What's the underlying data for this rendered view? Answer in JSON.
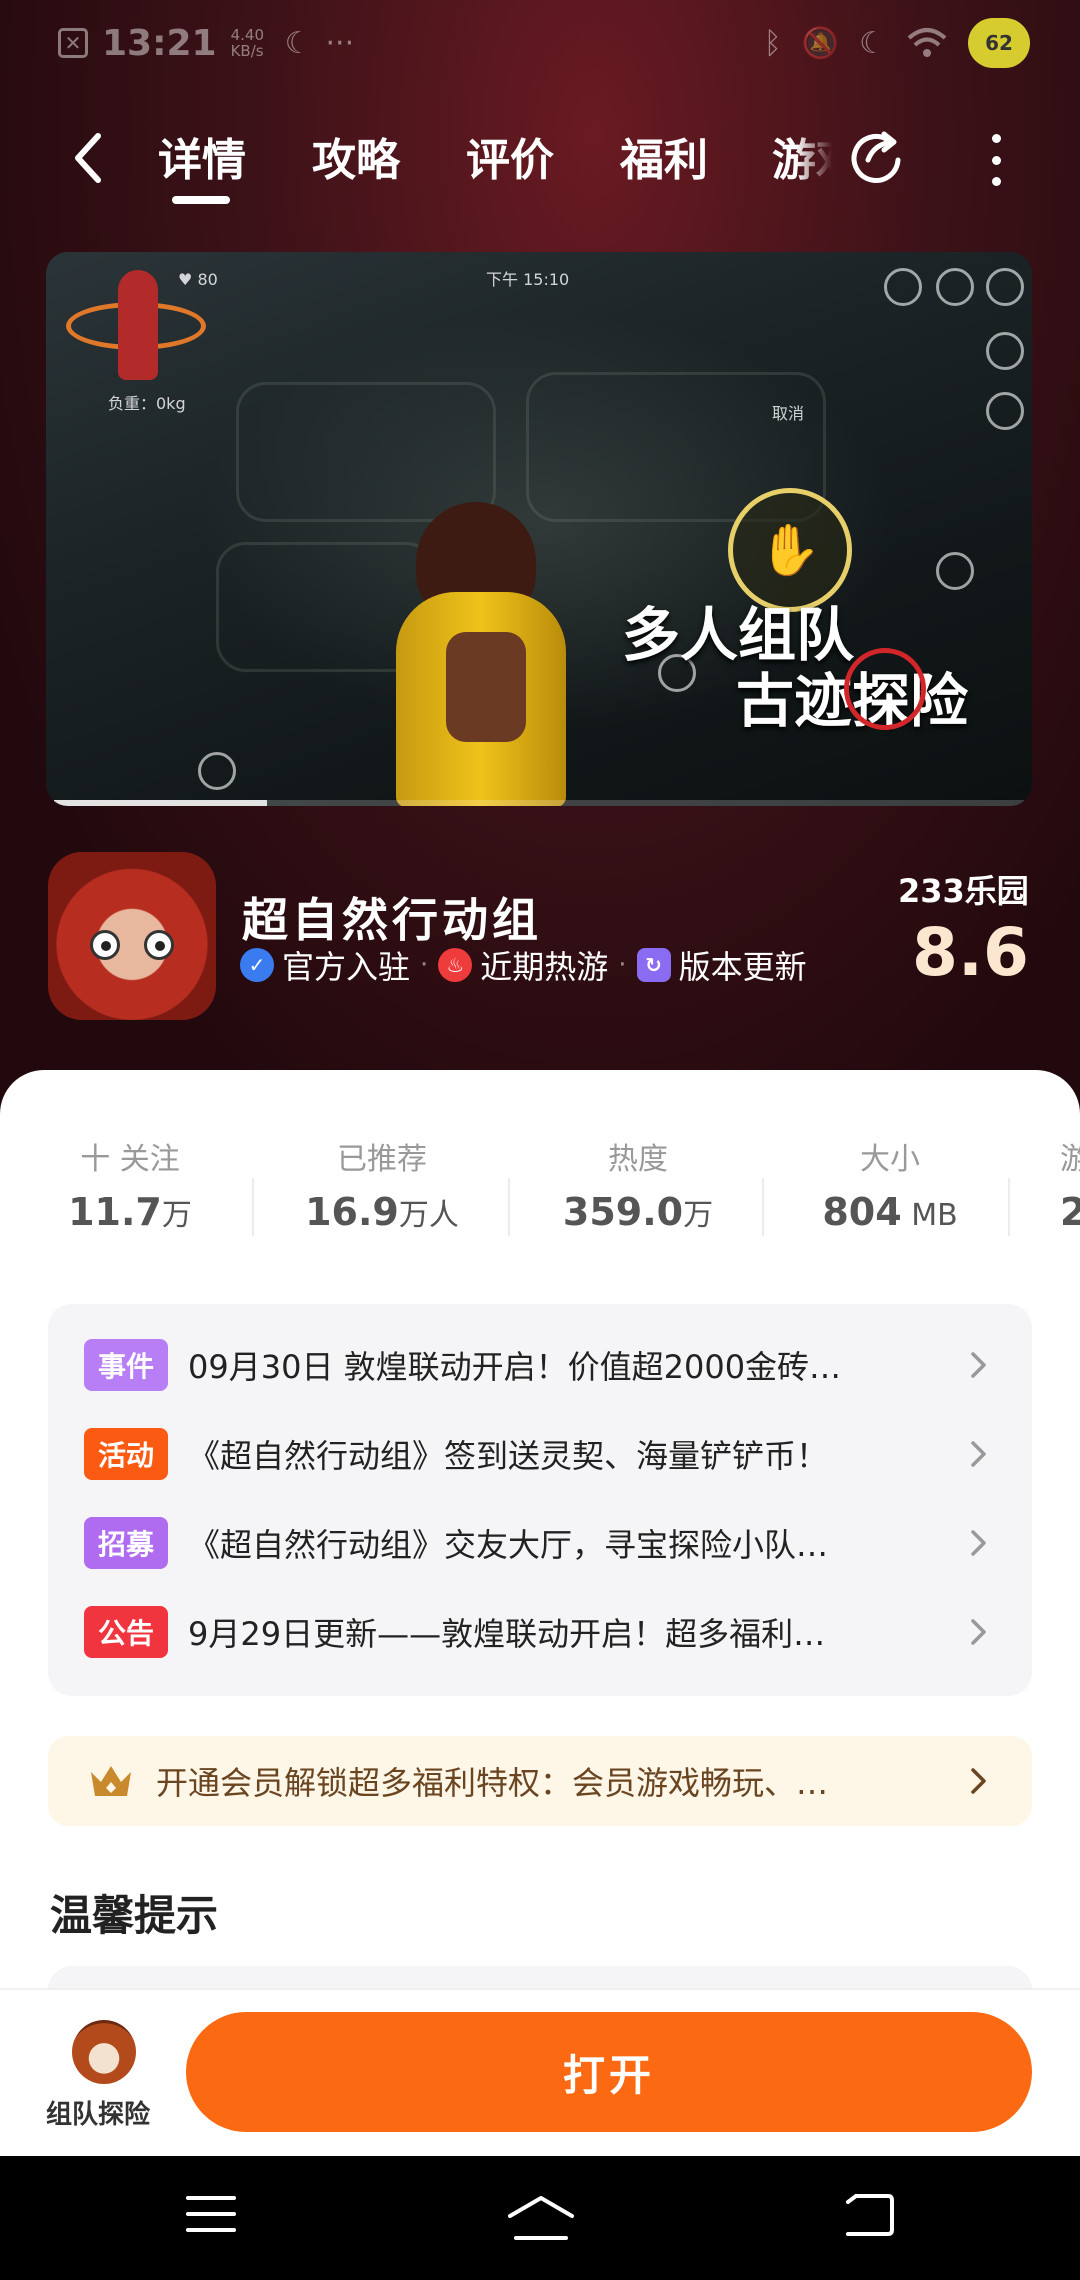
{
  "status_bar": {
    "time": "13:21",
    "net_speed_value": "4.40",
    "net_speed_unit": "KB/s",
    "more": "···",
    "battery": "62"
  },
  "nav": {
    "tabs": [
      {
        "label": "详情",
        "active": true
      },
      {
        "label": "攻略",
        "active": false
      },
      {
        "label": "评价",
        "active": false
      },
      {
        "label": "福利",
        "active": false
      }
    ],
    "partial_tab": "游戏"
  },
  "media": {
    "hud_time": "下午 15:10",
    "hud_cancel": "取消",
    "hud_weight": "负重：0kg",
    "hud_heart": "80",
    "promo_line1": "多人组队",
    "promo_line2": "古迹探险",
    "progress": 0.22
  },
  "app": {
    "name": "超自然行动组",
    "tags": [
      {
        "label": "官方入驻",
        "icon": "verified-icon",
        "color": "#3a7cf0"
      },
      {
        "label": "近期热游",
        "icon": "fire-icon",
        "color": "#ee3b3b"
      },
      {
        "label": "版本更新",
        "icon": "refresh-icon",
        "color": "#8a6cf3"
      }
    ],
    "rating_source": "233乐园",
    "rating": "8.6"
  },
  "stats": [
    {
      "label": "十 关注",
      "value": "11.7",
      "unit": "万"
    },
    {
      "label": "已推荐",
      "value": "16.9",
      "unit": "万人"
    },
    {
      "label": "热度",
      "value": "359.0",
      "unit": "万"
    },
    {
      "label": "大小",
      "value": "804",
      "unit": " MB"
    },
    {
      "label": "游",
      "value": "2",
      "unit": ""
    }
  ],
  "events": [
    {
      "badge": "事件",
      "color": "#b77ef5",
      "text": "09月30日  敦煌联动开启！价值超2000金砖…"
    },
    {
      "badge": "活动",
      "color": "#fb5a12",
      "text": "《超自然行动组》签到送灵契、海量铲铲币！"
    },
    {
      "badge": "招募",
      "color": "#b06cf0",
      "text": "《超自然行动组》交友大厅，寻宝探险小队…"
    },
    {
      "badge": "公告",
      "color": "#f0353f",
      "text": "9月29日更新——敦煌联动开启！超多福利…"
    }
  ],
  "vip": {
    "text": "开通会员解锁超多福利特权：会员游戏畅玩、…"
  },
  "tips": {
    "title": "温馨提示"
  },
  "action_bar": {
    "mascot_label": "组队探险",
    "open_label": "打开"
  },
  "colors": {
    "accent": "#fb6a12",
    "hero_bg": "#3c1218",
    "rating": "#fbe7cf"
  }
}
